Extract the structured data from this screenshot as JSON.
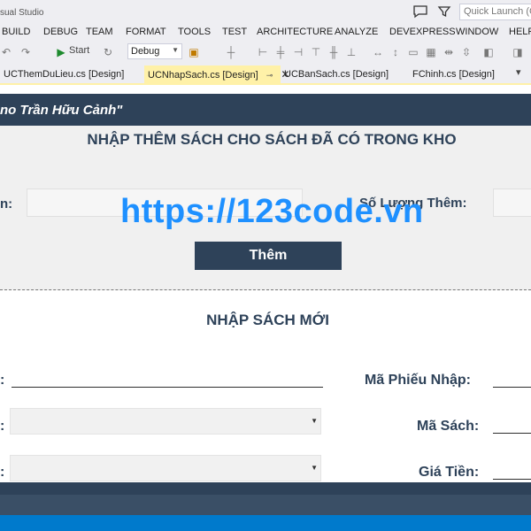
{
  "window": {
    "app_title": "sual Studio",
    "quick_launch_placeholder": "Quick Launch (C"
  },
  "menu": {
    "items": [
      "BUILD",
      "DEBUG",
      "TEAM",
      "FORMAT",
      "TOOLS",
      "TEST",
      "ARCHITECTURE",
      "ANALYZE",
      "DEVEXPRESS",
      "WINDOW",
      "HELP"
    ]
  },
  "toolbar": {
    "start_label": "Start",
    "config_value": "Debug"
  },
  "tabs": [
    {
      "label": "UCThemDuLieu.cs [Design]",
      "active": false
    },
    {
      "label": "UCNhapSach.cs [Design]",
      "active": true
    },
    {
      "label": "UCBanSach.cs [Design]",
      "active": false
    },
    {
      "label": "FChinh.cs [Design]",
      "active": false
    }
  ],
  "form": {
    "author_banner": "no Trần Hữu Cảnh\"",
    "section1_title": "NHẬP THÊM SÁCH CHO SÁCH ĐÃ CÓ TRONG KHO",
    "section1_left_label": "n:",
    "section1_right_label": "Số Lượng Thêm:",
    "add_button_label": "Thêm",
    "watermark": "https://123code.vn",
    "section2_title": "NHẬP SÁCH MỚI",
    "row1_left_label": ":",
    "row1_right_label": "Mã Phiếu Nhập:",
    "row2_left_label": ":",
    "row2_right_label": "Mã Sách:",
    "row3_left_label": ":",
    "row3_right_label": "Giá Tiền:"
  },
  "colors": {
    "header_band": "#2e4259",
    "active_tab": "#fff1a8",
    "status_bar": "#007acc",
    "watermark": "#1e90ff"
  }
}
